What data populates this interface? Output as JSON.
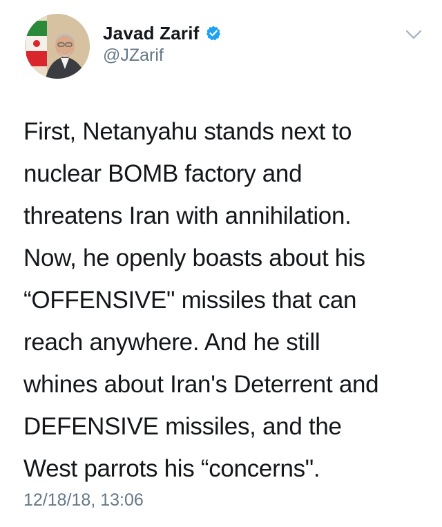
{
  "author": {
    "display_name": "Javad Zarif",
    "handle": "@JZarif",
    "verified": true,
    "avatar_icon": "profile-photo",
    "verified_icon": "verified-badge-icon"
  },
  "tweet": {
    "lines": [
      "First, Netanyahu stands next to",
      "nuclear BOMB factory and",
      "threatens Iran with annihilation.",
      "Now, he openly boasts about his",
      "“OFFENSIVE\" missiles that can",
      "reach anywhere. And he still",
      "whines about Iran's Deterrent and",
      "DEFENSIVE missiles, and the",
      "West parrots his “concerns\"."
    ],
    "timestamp": "12/18/18, 13:06"
  },
  "menu": {
    "icon": "chevron-down-icon"
  },
  "colors": {
    "text": "#14171a",
    "secondary": "#657786",
    "verified": "#1da1f2",
    "background": "#ffffff"
  }
}
